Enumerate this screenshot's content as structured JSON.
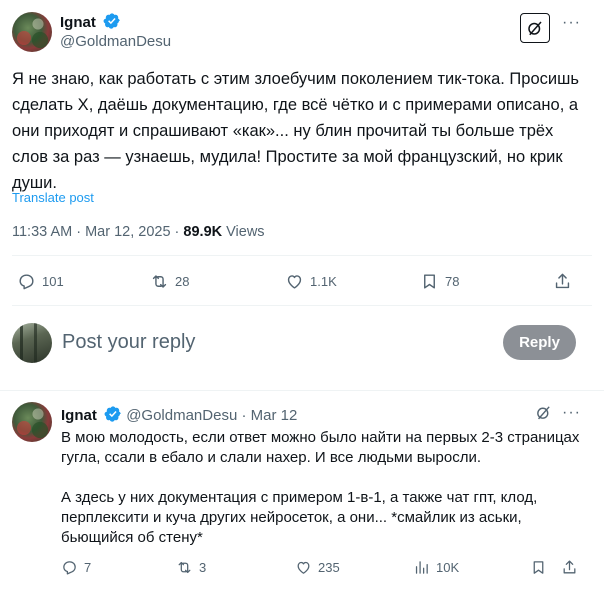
{
  "post": {
    "author_name": "Ignat",
    "author_handle": "@GoldmanDesu",
    "text": "Я не знаю, как работать с этим злоебучим поколением тик-тока. Просишь сделать X, даёшь документацию, где всё чётко и с примерами описано, а они приходят и спрашивают «как»... ну блин прочитай ты больше трёх слов за раз — узнаешь, мудила! Простите за мой французский, но крик души.",
    "translate_label": "Translate post",
    "timestamp": "11:33 AM · Mar 12, 2025 · ",
    "views_count": "89.9K",
    "views_label": " Views",
    "actions": {
      "replies": "101",
      "reposts": "28",
      "likes": "1.1K",
      "bookmarks": "78"
    }
  },
  "composer": {
    "placeholder": "Post your reply",
    "reply_button": "Reply"
  },
  "reply": {
    "author_name": "Ignat",
    "author_handle": "@GoldmanDesu",
    "date": " · Mar 12",
    "text1": "В мою молодость, если ответ можно было найти на первых 2-3 страницах гугла, ссали в ебало и слали нахер. И все людьми выросли.",
    "text2": "А здесь у них документация с примером 1-в-1, а также чат гпт, клод, перплексити и куча других нейросеток, а они... *смайлик из аськи, бьющийся об стену*",
    "actions": {
      "replies": "7",
      "reposts": "3",
      "likes": "235",
      "views": "10K"
    }
  },
  "icons": {
    "verified": "verified-badge-icon",
    "grok": "grok-icon",
    "more": "more-icon",
    "reply": "reply-icon",
    "repost": "repost-icon",
    "like": "heart-icon",
    "bookmark": "bookmark-icon",
    "share": "share-icon",
    "views": "views-icon"
  },
  "colors": {
    "accent": "#1d9bf0",
    "secondary_text": "#536471",
    "reply_button_bg": "#8c9096"
  }
}
